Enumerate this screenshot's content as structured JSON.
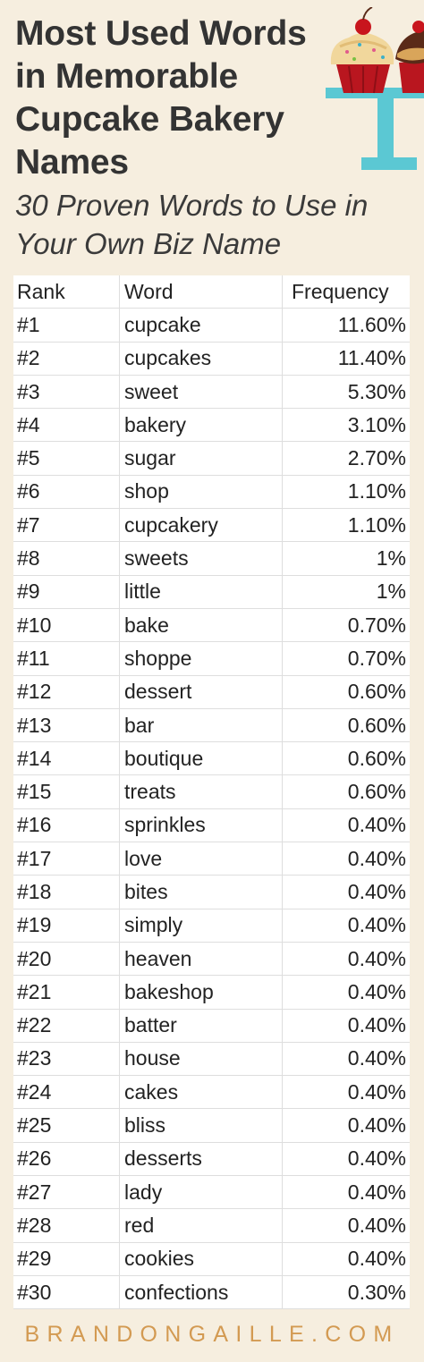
{
  "title": "Most Used Words in Memorable Cupcake Bakery Names",
  "subtitle": "30 Proven Words to Use in Your Own Biz Name",
  "table": {
    "headers": [
      "Rank",
      "Word",
      "Frequency"
    ],
    "rows": [
      [
        "#1",
        "cupcake",
        "11.60%"
      ],
      [
        "#2",
        "cupcakes",
        "11.40%"
      ],
      [
        "#3",
        "sweet",
        "5.30%"
      ],
      [
        "#4",
        "bakery",
        "3.10%"
      ],
      [
        "#5",
        "sugar",
        "2.70%"
      ],
      [
        "#6",
        "shop",
        "1.10%"
      ],
      [
        "#7",
        "cupcakery",
        "1.10%"
      ],
      [
        "#8",
        "sweets",
        "1%"
      ],
      [
        "#9",
        "little",
        "1%"
      ],
      [
        "#10",
        "bake",
        "0.70%"
      ],
      [
        "#11",
        "shoppe",
        "0.70%"
      ],
      [
        "#12",
        "dessert",
        "0.60%"
      ],
      [
        "#13",
        "bar",
        "0.60%"
      ],
      [
        "#14",
        "boutique",
        "0.60%"
      ],
      [
        "#15",
        "treats",
        "0.60%"
      ],
      [
        "#16",
        "sprinkles",
        "0.40%"
      ],
      [
        "#17",
        "love",
        "0.40%"
      ],
      [
        "#18",
        "bites",
        "0.40%"
      ],
      [
        "#19",
        "simply",
        "0.40%"
      ],
      [
        "#20",
        "heaven",
        "0.40%"
      ],
      [
        "#21",
        "bakeshop",
        "0.40%"
      ],
      [
        "#22",
        "batter",
        "0.40%"
      ],
      [
        "#23",
        "house",
        "0.40%"
      ],
      [
        "#24",
        "cakes",
        "0.40%"
      ],
      [
        "#25",
        "bliss",
        "0.40%"
      ],
      [
        "#26",
        "desserts",
        "0.40%"
      ],
      [
        "#27",
        "lady",
        "0.40%"
      ],
      [
        "#28",
        "red",
        "0.40%"
      ],
      [
        "#29",
        "cookies",
        "0.40%"
      ],
      [
        "#30",
        "confections",
        "0.30%"
      ]
    ]
  },
  "footer": "BRANDONGAILLE.COM",
  "colors": {
    "background": "#f6eedf",
    "footer_text": "#d39a52",
    "cake_stand": "#5bc8d3",
    "frosting": "#f1d79c",
    "cupcake_wrapper": "#b9161f",
    "cherry": "#c8151d"
  },
  "icons": [
    "cupcake-icon",
    "cupcake-icon",
    "cake-stand-icon",
    "cherry-icon"
  ]
}
